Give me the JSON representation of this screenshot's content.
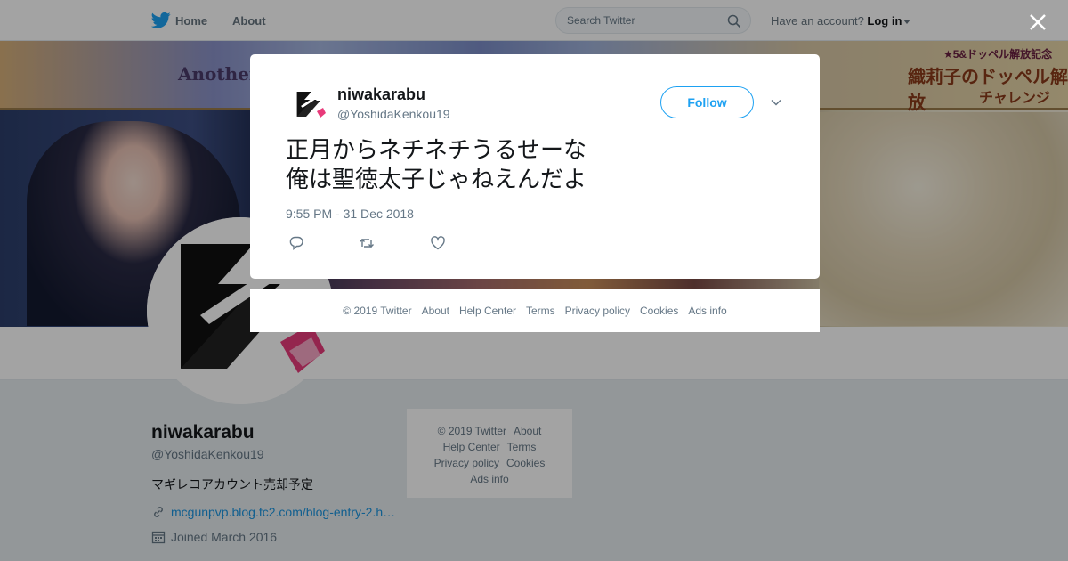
{
  "nav": {
    "home_label": "Home",
    "about_label": "About",
    "search_placeholder": "Search Twitter",
    "have_account": "Have an account?",
    "login_label": "Log in"
  },
  "banner": {
    "text_left": "Another Daze",
    "text_right_top": "★5&ドッペル解放記念",
    "text_right_main": "織莉子のドッペル解放",
    "text_right_sub": "チャレンジ"
  },
  "profile": {
    "name": "niwakarabu",
    "handle": "@YoshidaKenkou19",
    "bio": "マギレコアカウント売却予定",
    "link": "mcgunpvp.blog.fc2.com/blog-entry-2.h…",
    "joined": "Joined March 2016"
  },
  "side_footer": {
    "copyright": "© 2019 Twitter",
    "about": "About",
    "help": "Help Center",
    "terms": "Terms",
    "privacy": "Privacy policy",
    "cookies": "Cookies",
    "ads": "Ads info"
  },
  "tweet": {
    "author_name": "niwakarabu",
    "author_handle": "@YoshidaKenkou19",
    "follow_label": "Follow",
    "text": "正月からネチネチうるせーな\n俺は聖徳太子じゃねえんだよ",
    "timestamp": "9:55 PM - 31 Dec 2018"
  },
  "modal_footer": {
    "copyright": "© 2019 Twitter",
    "about": "About",
    "help": "Help Center",
    "terms": "Terms",
    "privacy": "Privacy policy",
    "cookies": "Cookies",
    "ads": "Ads info"
  },
  "colors": {
    "twitter_blue": "#1da1f2",
    "link_green": "#1b95e0",
    "muted": "#657786"
  },
  "icons": [
    "twitter-bird-icon",
    "search-icon",
    "close-icon",
    "chevron-down-icon",
    "reply-icon",
    "retweet-icon",
    "like-icon",
    "link-icon",
    "calendar-icon"
  ]
}
